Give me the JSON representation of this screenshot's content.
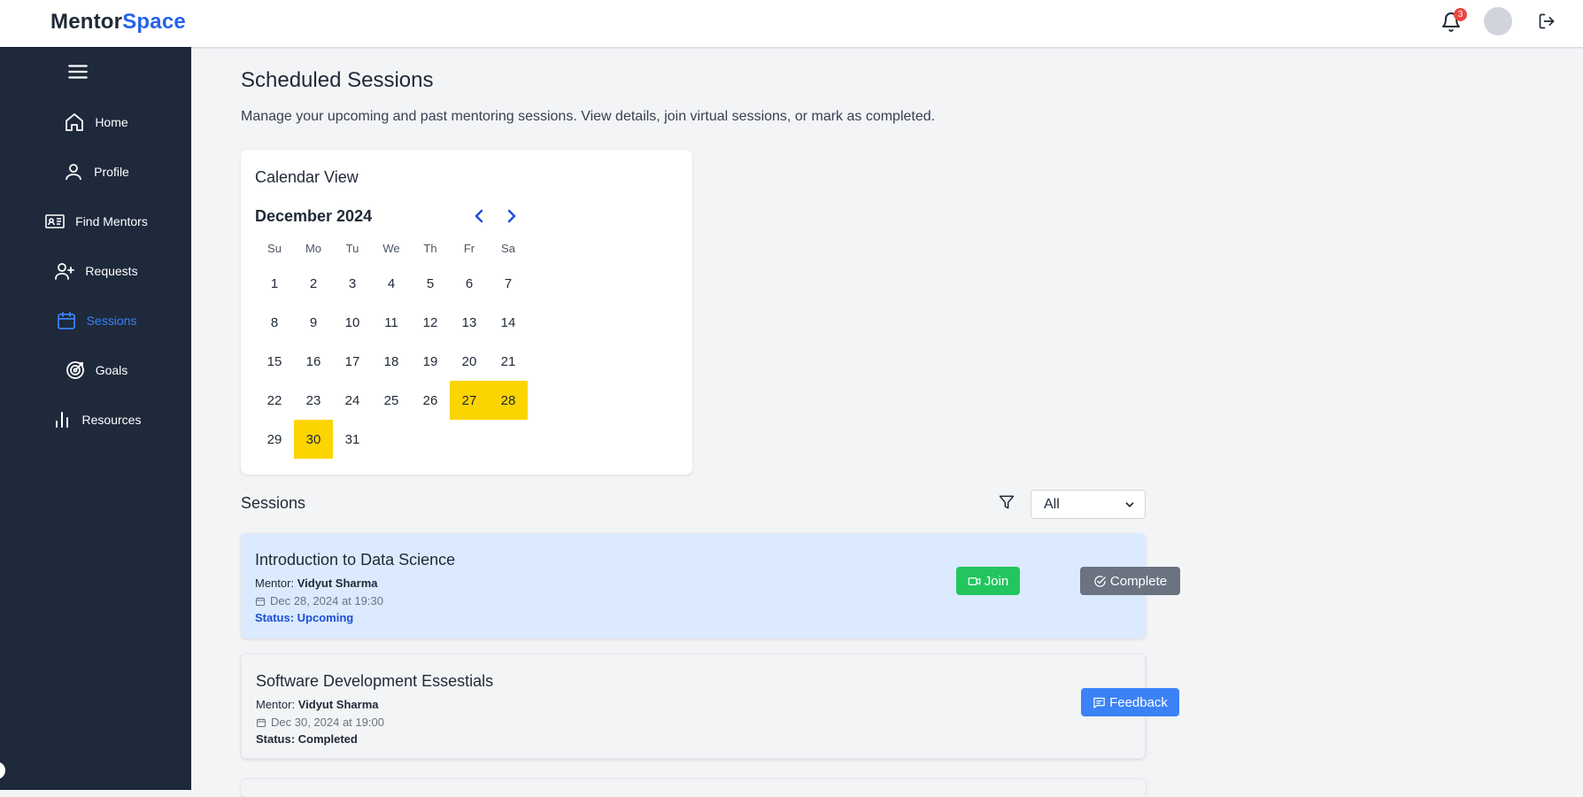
{
  "app": {
    "logo_part1": "Mentor",
    "logo_part2": "Space"
  },
  "header": {
    "notification_count": "3"
  },
  "sidebar": {
    "items": [
      {
        "label": "Home",
        "icon": "home-icon"
      },
      {
        "label": "Profile",
        "icon": "user-icon"
      },
      {
        "label": "Find Mentors",
        "icon": "id-card-icon"
      },
      {
        "label": "Requests",
        "icon": "user-plus-icon"
      },
      {
        "label": "Sessions",
        "icon": "calendar-icon",
        "active": true
      },
      {
        "label": "Goals",
        "icon": "target-icon"
      },
      {
        "label": "Resources",
        "icon": "bar-chart-icon"
      }
    ]
  },
  "page": {
    "title": "Scheduled Sessions",
    "description": "Manage your upcoming and past mentoring sessions. View details, join virtual sessions, or mark as completed."
  },
  "calendar": {
    "title": "Calendar View",
    "month_label": "December 2024",
    "weekdays": [
      "Su",
      "Mo",
      "Tu",
      "We",
      "Th",
      "Fr",
      "Sa"
    ],
    "days": [
      "1",
      "2",
      "3",
      "4",
      "5",
      "6",
      "7",
      "8",
      "9",
      "10",
      "11",
      "12",
      "13",
      "14",
      "15",
      "16",
      "17",
      "18",
      "19",
      "20",
      "21",
      "22",
      "23",
      "24",
      "25",
      "26",
      "27",
      "28",
      "29",
      "30",
      "31"
    ],
    "highlighted_days": [
      "27",
      "28",
      "30"
    ],
    "highlight_color": "#fcd400"
  },
  "sessions_section": {
    "title": "Sessions",
    "filter_value": "All"
  },
  "sessions": [
    {
      "title": "Introduction to Data Science",
      "mentor_label": "Mentor:",
      "mentor_name": "Vidyut Sharma",
      "datetime": "Dec 28, 2024 at 19:30",
      "status": "Status: Upcoming",
      "status_color": "#1d4ed8",
      "join_label": "Join",
      "complete_label": "Complete"
    },
    {
      "title": "Software Development Essestials",
      "mentor_label": "Mentor:",
      "mentor_name": "Vidyut Sharma",
      "datetime": "Dec 30, 2024 at 19:00",
      "status": "Status: Completed",
      "status_color": "#1f2937",
      "feedback_label": "Feedback"
    }
  ],
  "colors": {
    "sidebar_bg": "#1e293b",
    "accent": "#2563eb",
    "join": "#22c55e",
    "complete": "#6b7280",
    "feedback": "#3b82f6"
  }
}
